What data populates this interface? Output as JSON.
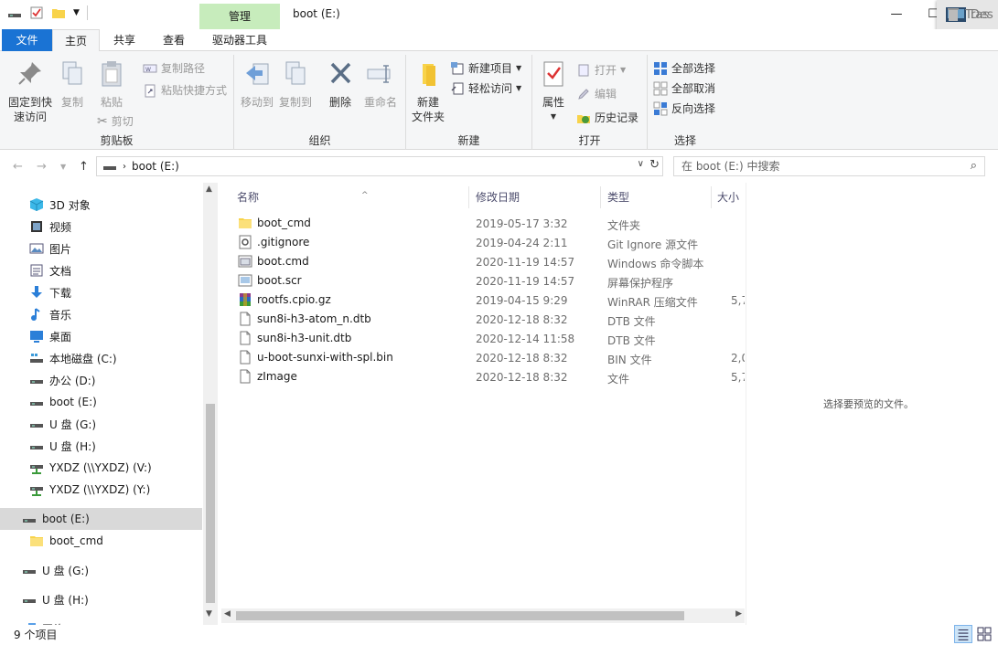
{
  "window": {
    "title": "boot (E:)",
    "manage_tab": "管理",
    "controls": {
      "minimize": "—",
      "maximize": "☐",
      "close": "✕"
    }
  },
  "overlay": {
    "item1": "Des",
    "item2": "Tras"
  },
  "tabs": {
    "file": "文件",
    "home": "主页",
    "share": "共享",
    "view": "查看",
    "drive_tools": "驱动器工具"
  },
  "ribbon": {
    "clipboard": {
      "label": "剪贴板",
      "pin": "固定到快速访问",
      "pin_line1": "固定到快",
      "pin_line2": "速访问",
      "copy": "复制",
      "paste": "粘贴",
      "copy_path": "复制路径",
      "paste_shortcut": "粘贴快捷方式",
      "cut": "剪切"
    },
    "organize": {
      "label": "组织",
      "move_to": "移动到",
      "copy_to": "复制到",
      "delete": "删除",
      "rename": "重命名"
    },
    "new": {
      "label": "新建",
      "new_folder_line1": "新建",
      "new_folder_line2": "文件夹",
      "new_item": "新建项目",
      "easy_access": "轻松访问"
    },
    "open": {
      "label": "打开",
      "properties": "属性",
      "open": "打开",
      "edit": "编辑",
      "history": "历史记录"
    },
    "select": {
      "label": "选择",
      "select_all": "全部选择",
      "select_none": "全部取消",
      "invert": "反向选择"
    }
  },
  "address": {
    "path": "boot (E:)",
    "search_placeholder": "在 boot (E:) 中搜索"
  },
  "nav": [
    {
      "label": "3D 对象",
      "icon": "3d-objects-icon"
    },
    {
      "label": "视频",
      "icon": "video-icon"
    },
    {
      "label": "图片",
      "icon": "pictures-icon"
    },
    {
      "label": "文档",
      "icon": "documents-icon"
    },
    {
      "label": "下载",
      "icon": "download-icon"
    },
    {
      "label": "音乐",
      "icon": "music-icon"
    },
    {
      "label": "桌面",
      "icon": "desktop-icon"
    },
    {
      "label": "本地磁盘 (C:)",
      "icon": "system-drive-icon"
    },
    {
      "label": "办公 (D:)",
      "icon": "drive-icon"
    },
    {
      "label": "boot (E:)",
      "icon": "drive-icon"
    },
    {
      "label": "U 盘 (G:)",
      "icon": "drive-icon"
    },
    {
      "label": "U 盘 (H:)",
      "icon": "drive-icon"
    },
    {
      "label": "YXDZ (\\\\YXDZ) (V:)",
      "icon": "network-drive-icon"
    },
    {
      "label": "YXDZ (\\\\YXDZ) (Y:)",
      "icon": "network-drive-icon"
    },
    {
      "label": "boot (E:)",
      "icon": "drive-icon"
    },
    {
      "label": "boot_cmd",
      "icon": "folder-icon"
    },
    {
      "label": "U 盘 (G:)",
      "icon": "drive-icon"
    },
    {
      "label": "U 盘 (H:)",
      "icon": "drive-icon"
    },
    {
      "label": "网络",
      "icon": "network-icon"
    }
  ],
  "columns": {
    "name": "名称",
    "date": "修改日期",
    "type": "类型",
    "size": "大小"
  },
  "files": [
    {
      "name": "boot_cmd",
      "date": "2019-05-17 3:32",
      "type": "文件夹",
      "size": "",
      "icon": "folder-icon"
    },
    {
      "name": ".gitignore",
      "date": "2019-04-24 2:11",
      "type": "Git Ignore 源文件",
      "size": "",
      "icon": "gitignore-file-icon"
    },
    {
      "name": "boot.cmd",
      "date": "2020-11-19 14:57",
      "type": "Windows 命令脚本",
      "size": "",
      "icon": "cmd-script-icon"
    },
    {
      "name": "boot.scr",
      "date": "2020-11-19 14:57",
      "type": "屏幕保护程序",
      "size": "",
      "icon": "screensaver-icon"
    },
    {
      "name": "rootfs.cpio.gz",
      "date": "2019-04-15 9:29",
      "type": "WinRAR 压缩文件",
      "size": "5,7",
      "icon": "winrar-icon"
    },
    {
      "name": "sun8i-h3-atom_n.dtb",
      "date": "2020-12-18 8:32",
      "type": "DTB 文件",
      "size": "",
      "icon": "file-icon"
    },
    {
      "name": "sun8i-h3-unit.dtb",
      "date": "2020-12-14 11:58",
      "type": "DTB 文件",
      "size": "",
      "icon": "file-icon"
    },
    {
      "name": "u-boot-sunxi-with-spl.bin",
      "date": "2020-12-18 8:32",
      "type": "BIN 文件",
      "size": "2,0",
      "icon": "file-icon"
    },
    {
      "name": "zImage",
      "date": "2020-12-18 8:32",
      "type": "文件",
      "size": "5,7",
      "icon": "file-icon"
    }
  ],
  "preview": {
    "message": "选择要预览的文件。"
  },
  "status": {
    "count": "9 个项目"
  }
}
